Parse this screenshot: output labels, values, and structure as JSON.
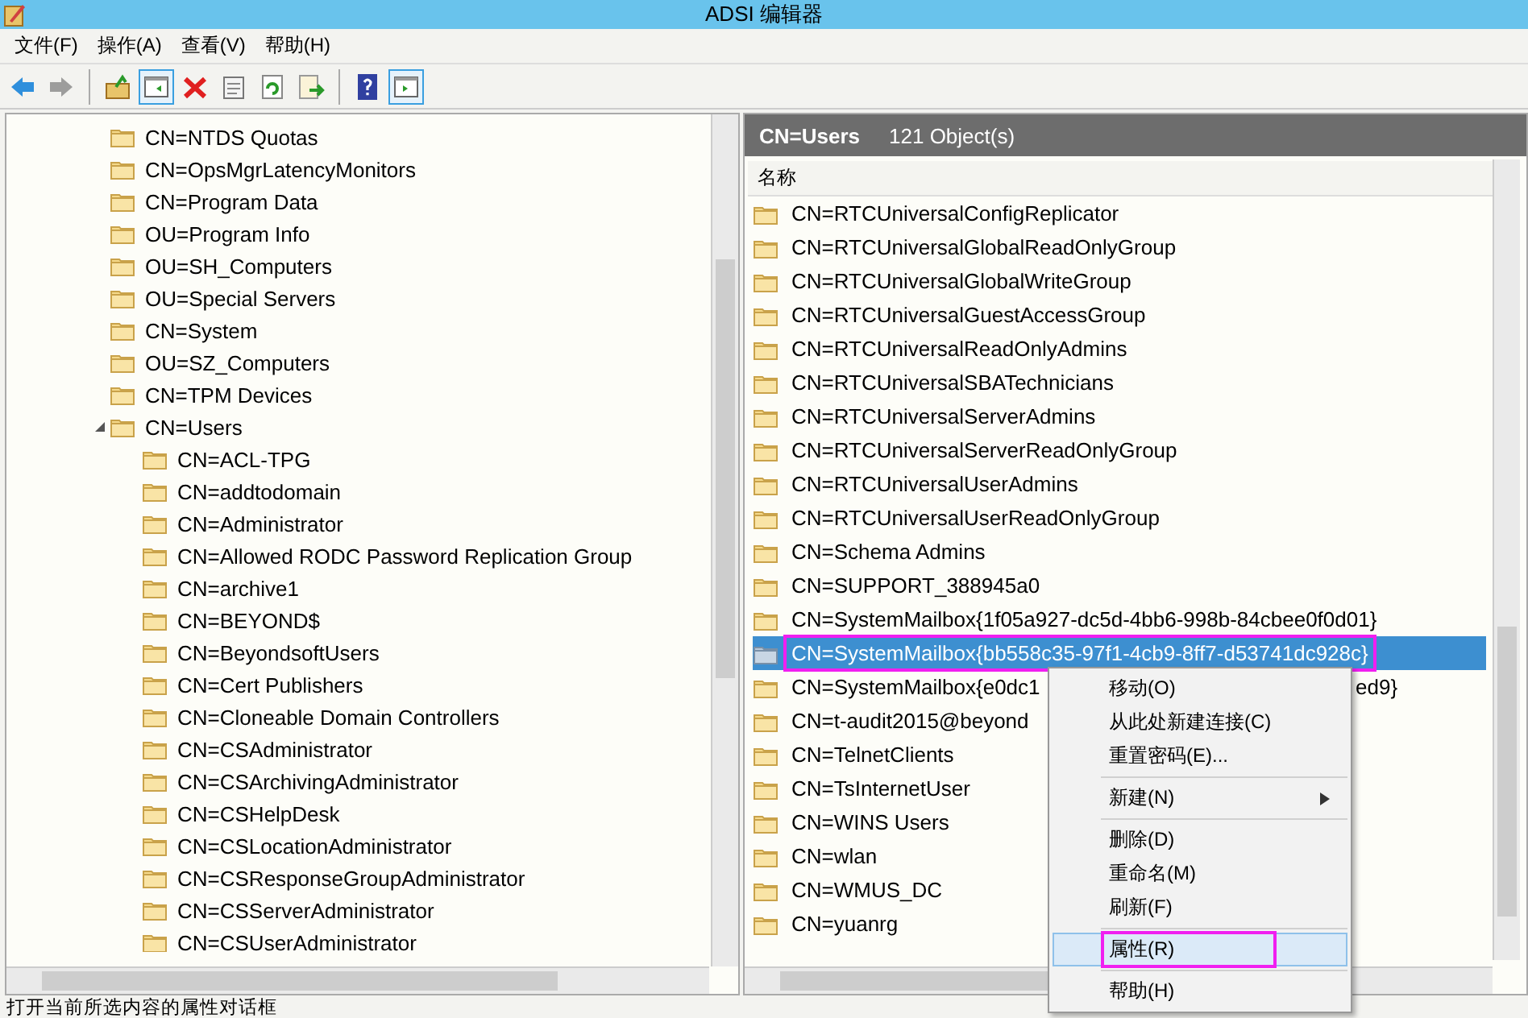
{
  "window": {
    "title": "ADSI 编辑器"
  },
  "menu_bar": [
    "文件(F)",
    "操作(A)",
    "查看(V)",
    "帮助(H)"
  ],
  "toolbar": [
    {
      "kind": "back",
      "disabled": false,
      "pressed": false
    },
    {
      "kind": "forward",
      "disabled": true,
      "pressed": false
    },
    {
      "kind": "separator"
    },
    {
      "kind": "up",
      "disabled": false,
      "pressed": false
    },
    {
      "kind": "pane",
      "disabled": false,
      "pressed": true
    },
    {
      "kind": "delete",
      "disabled": false,
      "pressed": false
    },
    {
      "kind": "properties",
      "disabled": false,
      "pressed": false
    },
    {
      "kind": "refresh",
      "disabled": false,
      "pressed": false
    },
    {
      "kind": "export",
      "disabled": false,
      "pressed": false
    },
    {
      "kind": "separator"
    },
    {
      "kind": "help",
      "disabled": false,
      "pressed": false
    },
    {
      "kind": "action-pane",
      "disabled": false,
      "pressed": true
    }
  ],
  "tree": [
    {
      "label": "CN=NTDS Quotas"
    },
    {
      "label": "CN=OpsMgrLatencyMonitors"
    },
    {
      "label": "CN=Program Data"
    },
    {
      "label": "OU=Program Info"
    },
    {
      "label": "OU=SH_Computers"
    },
    {
      "label": "OU=Special Servers"
    },
    {
      "label": "CN=System"
    },
    {
      "label": "OU=SZ_Computers"
    },
    {
      "label": "CN=TPM Devices"
    },
    {
      "label": "CN=Users",
      "expanded": true,
      "children": [
        {
          "label": "CN=ACL-TPG"
        },
        {
          "label": "CN=addtodomain"
        },
        {
          "label": "CN=Administrator"
        },
        {
          "label": "CN=Allowed RODC Password Replication Group"
        },
        {
          "label": "CN=archive1"
        },
        {
          "label": "CN=BEYOND$"
        },
        {
          "label": "CN=BeyondsoftUsers"
        },
        {
          "label": "CN=Cert Publishers"
        },
        {
          "label": "CN=Cloneable Domain Controllers"
        },
        {
          "label": "CN=CSAdministrator"
        },
        {
          "label": "CN=CSArchivingAdministrator"
        },
        {
          "label": "CN=CSHelpDesk"
        },
        {
          "label": "CN=CSLocationAdministrator"
        },
        {
          "label": "CN=CSResponseGroupAdministrator"
        },
        {
          "label": "CN=CSServerAdministrator"
        },
        {
          "label": "CN=CSUserAdministrator"
        }
      ]
    }
  ],
  "list": {
    "title": "CN=Users",
    "count": "121 Object(s)",
    "column": "名称",
    "rows": [
      {
        "text": "CN=RTCUniversalConfigReplicator",
        "selected": false
      },
      {
        "text": "CN=RTCUniversalGlobalReadOnlyGroup",
        "selected": false
      },
      {
        "text": "CN=RTCUniversalGlobalWriteGroup",
        "selected": false
      },
      {
        "text": "CN=RTCUniversalGuestAccessGroup",
        "selected": false
      },
      {
        "text": "CN=RTCUniversalReadOnlyAdmins",
        "selected": false
      },
      {
        "text": "CN=RTCUniversalSBATechnicians",
        "selected": false
      },
      {
        "text": "CN=RTCUniversalServerAdmins",
        "selected": false
      },
      {
        "text": "CN=RTCUniversalServerReadOnlyGroup",
        "selected": false
      },
      {
        "text": "CN=RTCUniversalUserAdmins",
        "selected": false
      },
      {
        "text": "CN=RTCUniversalUserReadOnlyGroup",
        "selected": false
      },
      {
        "text": "CN=Schema Admins",
        "selected": false
      },
      {
        "text": "CN=SUPPORT_388945a0",
        "selected": false
      },
      {
        "text": "CN=SystemMailbox{1f05a927-dc5d-4bb6-998b-84cbee0f0d01}",
        "selected": false
      },
      {
        "text": "CN=SystemMailbox{bb558c35-97f1-4cb9-8ff7-d53741dc928c}",
        "selected": true,
        "highlighted": true
      },
      {
        "text": "CN=SystemMailbox{e0dc1",
        "tail": "ed9}",
        "selected": false
      },
      {
        "text": "CN=t-audit2015@beyond",
        "selected": false
      },
      {
        "text": "CN=TelnetClients",
        "selected": false
      },
      {
        "text": "CN=TsInternetUser",
        "selected": false
      },
      {
        "text": "CN=WINS Users",
        "selected": false
      },
      {
        "text": "CN=wlan",
        "selected": false
      },
      {
        "text": "CN=WMUS_DC",
        "selected": false
      },
      {
        "text": "CN=yuanrg",
        "selected": false
      }
    ]
  },
  "context_menu": [
    {
      "kind": "item",
      "label": "移动(O)",
      "hover": false
    },
    {
      "kind": "item",
      "label": "从此处新建连接(C)",
      "hover": false
    },
    {
      "kind": "item",
      "label": "重置密码(E)...",
      "hover": false
    },
    {
      "kind": "separator"
    },
    {
      "kind": "submenu",
      "label": "新建(N)",
      "hover": false
    },
    {
      "kind": "separator"
    },
    {
      "kind": "item",
      "label": "删除(D)",
      "hover": false
    },
    {
      "kind": "item",
      "label": "重命名(M)",
      "hover": false
    },
    {
      "kind": "item",
      "label": "刷新(F)",
      "hover": false
    },
    {
      "kind": "separator"
    },
    {
      "kind": "item",
      "label": "属性(R)",
      "hover": true,
      "highlighted": true
    },
    {
      "kind": "separator"
    },
    {
      "kind": "item",
      "label": "帮助(H)",
      "hover": false
    }
  ],
  "status_bar": "打开当前所选内容的属性对话框"
}
